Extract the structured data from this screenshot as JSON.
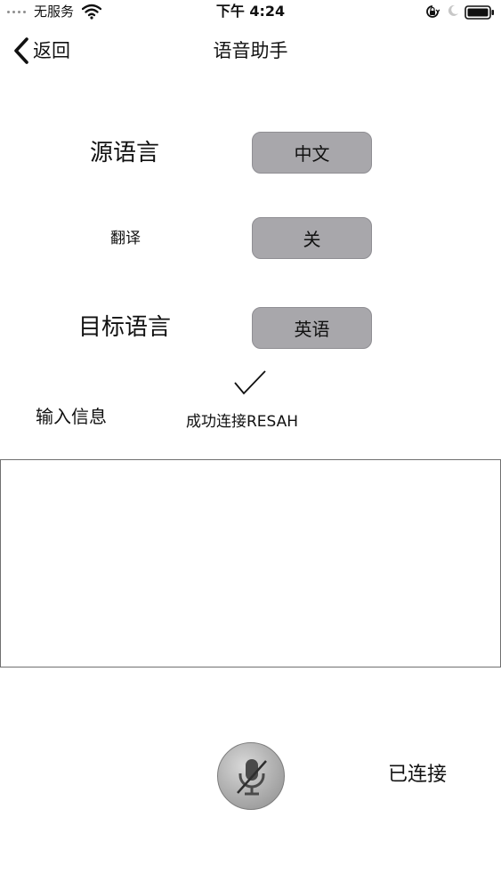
{
  "status_bar": {
    "carrier": "无服务",
    "time": "下午 4:24",
    "icons": [
      "signal-dots",
      "wifi-icon",
      "orientation-lock-icon",
      "moon-icon",
      "battery-icon"
    ]
  },
  "nav": {
    "back_label": "返回",
    "title": "语音助手"
  },
  "settings": {
    "source_label": "源语言",
    "source_value": "中文",
    "translate_label": "翻译",
    "translate_value": "关",
    "target_label": "目标语言",
    "target_value": "英语"
  },
  "input_section": {
    "label": "输入信息",
    "connection_status": "成功连接RESAH",
    "text_value": "",
    "placeholder": ""
  },
  "footer": {
    "connected_label": "已连接"
  },
  "colors": {
    "button_fill": "#a8a7ab",
    "button_border": "#8f8e93",
    "text": "#111111"
  }
}
